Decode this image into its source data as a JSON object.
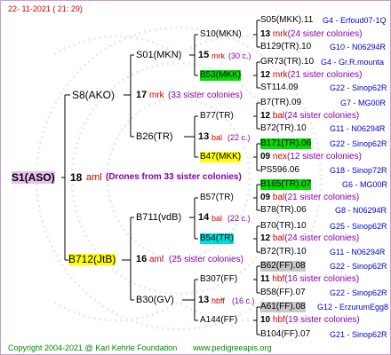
{
  "header": {
    "timestamp": "22- 11-2021 ( 21: 29)"
  },
  "footer": {
    "copyright": "Copyright 2004-2021 @ Karl Kehrle Foundation",
    "site": "www.pedigreeapis.org"
  },
  "root": {
    "id": "S1(ASO)",
    "num": "18",
    "mark": "aml",
    "note": "(Drones from 33 sister colonies)"
  },
  "sire_line": {
    "id": "S8(AKO)",
    "num": "17",
    "mark": "mrk",
    "note": "(33 sister colonies)",
    "sire": {
      "id": "S01(MKN)",
      "num": "15",
      "mark": "mrk",
      "note": "(30 c.)",
      "sire": {
        "id": "S10(MKN)",
        "num": "13",
        "mark": "mrk",
        "note": "(24 sister colonies)",
        "a": "S05(MKK).11",
        "a_tag": "G4 - Erfoud07-1Q",
        "b": "B129(TR).10",
        "b_tag": "G10 - N06294R"
      },
      "dam": {
        "id": "B53(MKK)",
        "num": "12",
        "mark": "mrk",
        "note": "(21 sister colonies)",
        "a": "GR73(TR).10",
        "a_tag": "G4 - Gr.R.mounta",
        "b": "ST114.09",
        "b_tag": "G22 - Sinop62R"
      }
    },
    "dam": {
      "id": "B26(TR)",
      "num": "13",
      "mark": "bal",
      "note": "(22 c.)",
      "sire": {
        "id": "B77(TR)",
        "num": "12",
        "mark": "bal",
        "note": "(24 sister colonies)",
        "a": "B7(TR).09",
        "a_tag": "G7 - MG00R",
        "b": "B72(TR).10",
        "b_tag": "G11 - N06294R"
      },
      "dam": {
        "id": "B47(MKK)",
        "num": "09",
        "mark": "nex",
        "note": "(12 sister colonies)",
        "a": "B171(TR).06",
        "a_tag": "G22 - Sinop62R",
        "b": "PS596.06",
        "b_tag": "G18 - Sinop72R"
      }
    }
  },
  "dam_line": {
    "id": "B712(JtB)",
    "num": "16",
    "mark": "aml",
    "note": "(25 sister colonies)",
    "sire": {
      "id": "B711(vdB)",
      "num": "14",
      "mark": "bal",
      "note": "(22 c.)",
      "sire": {
        "id": "B57(TR)",
        "num": "09",
        "mark": "bal",
        "note": "(21 sister colonies)",
        "a": "B165(TR).07",
        "a_tag": "G6 - MG00R",
        "b": "B78(TR).06",
        "b_tag": "G8 - N06294R"
      },
      "dam": {
        "id": "B54(TR)",
        "num": "12",
        "mark": "bal",
        "note": "(24 sister colonies)",
        "a": "B70(TR).10",
        "a_tag": "G25 - Sinop62R",
        "b": "B72(TR).10",
        "b_tag": "G11 - N06294R"
      }
    },
    "dam": {
      "id": "B30(GV)",
      "num": "13",
      "mark": "hbff",
      "note": "(16 c.)",
      "sire": {
        "id": "B307(FF)",
        "num": "11",
        "mark": "hbf",
        "note": "(16 sister colonies)",
        "a": "B62(FF).08",
        "a_tag": "G22 - Sinop62R",
        "b": "B58(FF).07",
        "b_tag": "G22 - Sinop62R"
      },
      "dam": {
        "id": "A144(FF)",
        "num": "10",
        "mark": "hbf",
        "note": "(19 sister colonies)",
        "a": "A61(FF).08",
        "a_tag": "G12 - ErzurumEgg8",
        "b": "B104(FF).07",
        "b_tag": "G21 - Sinop62R"
      }
    }
  },
  "colors": {
    "accent_red": "#cc0000",
    "accent_purple": "#8800aa",
    "tag_blue": "#0000cc",
    "highlight_green": "#00dd00",
    "highlight_yellow": "#ffff00",
    "highlight_cyan": "#00dddd",
    "highlight_gray": "#c8c8c8"
  }
}
